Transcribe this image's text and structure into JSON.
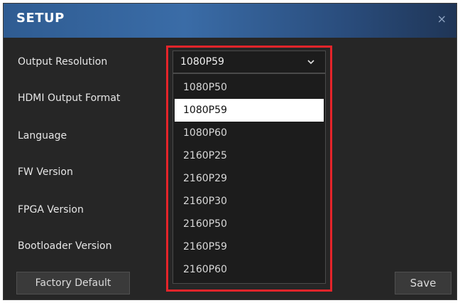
{
  "dialog": {
    "title": "SETUP",
    "close_glyph": "×"
  },
  "fields": {
    "output_resolution": "Output Resolution",
    "hdmi_output_format": "HDMI Output Format",
    "language": "Language",
    "fw_version": "FW Version",
    "fpga_version": "FPGA Version",
    "bootloader_version": "Bootloader Version"
  },
  "resolution_select": {
    "value": "1080P59",
    "icon": "chevron-down-icon",
    "options": [
      "1080P50",
      "1080P59",
      "1080P60",
      "2160P25",
      "2160P29",
      "2160P30",
      "2160P50",
      "2160P59",
      "2160P60"
    ],
    "selected_option": "1080P59"
  },
  "buttons": {
    "factory_default": "Factory Default",
    "save": "Save"
  },
  "colors": {
    "title_bar": "#3a6ca7",
    "dialog_bg": "#262626",
    "highlight_border": "#e5242a",
    "selected_option_bg": "#ffffff"
  }
}
